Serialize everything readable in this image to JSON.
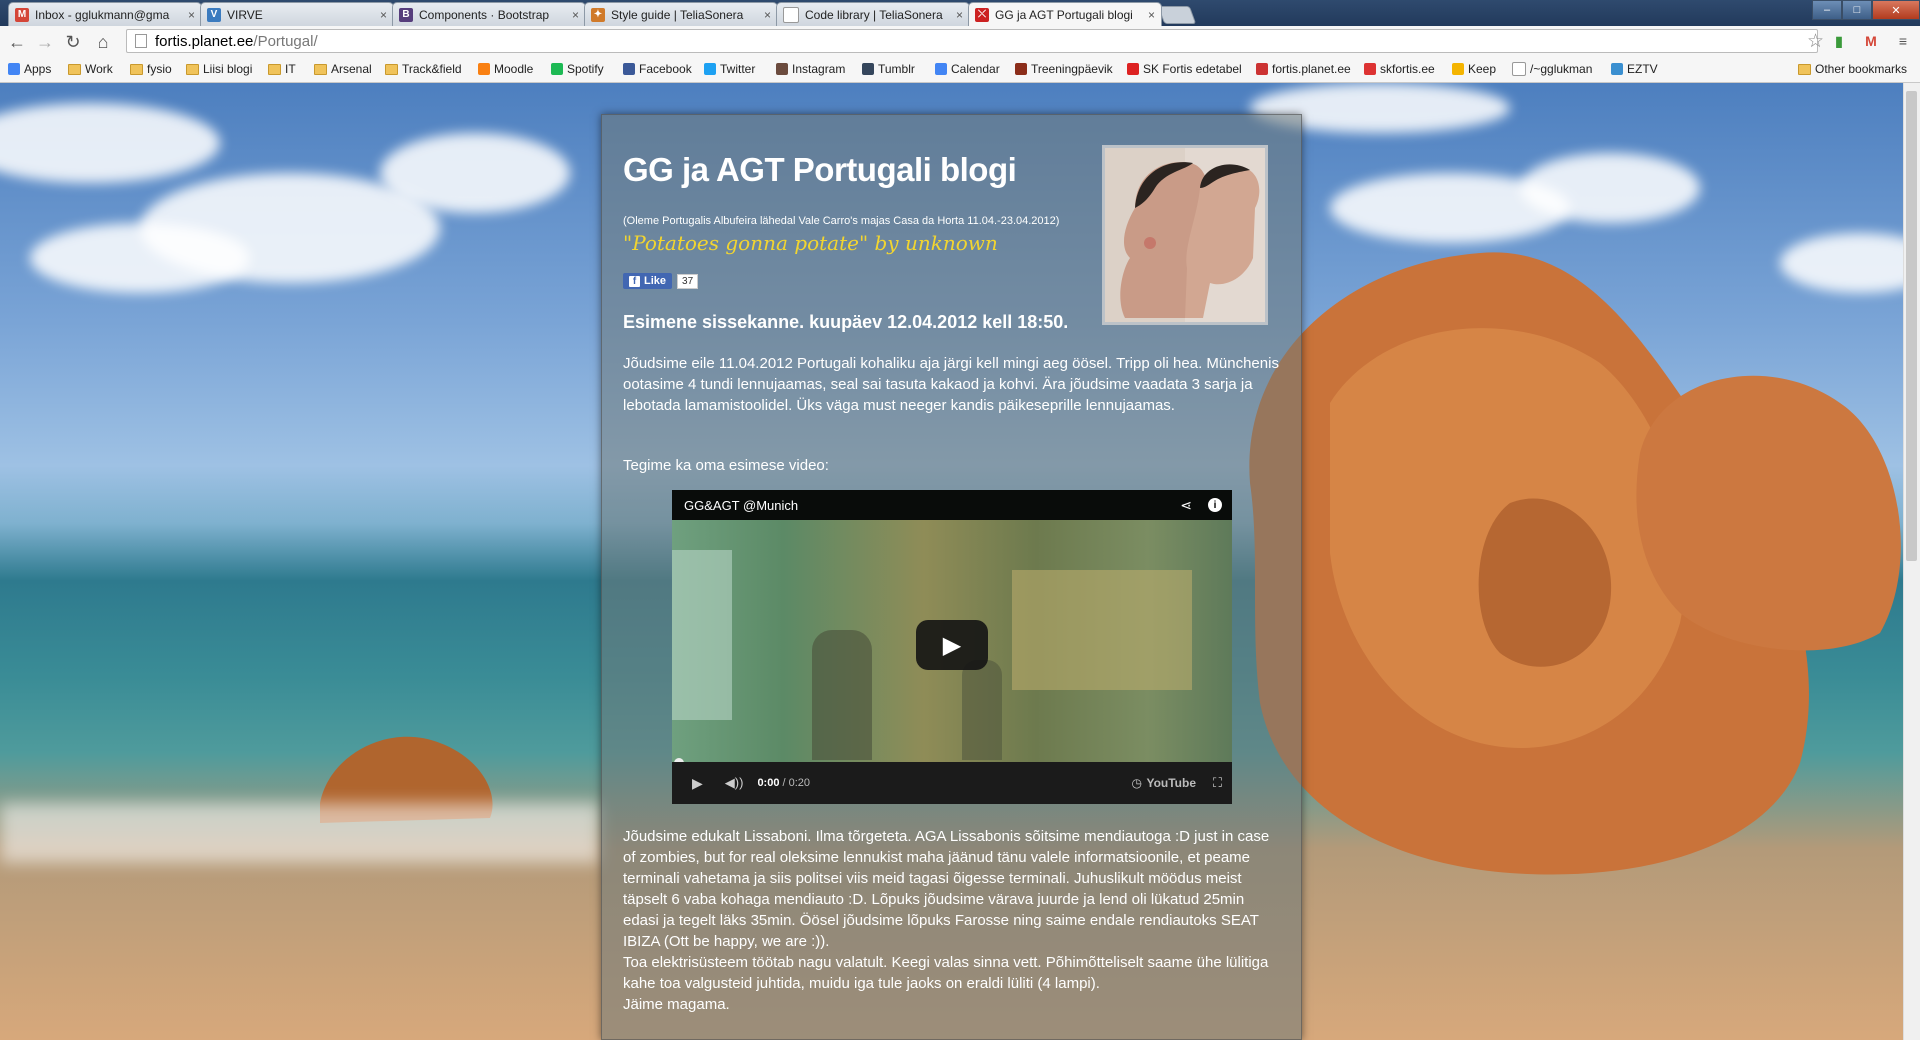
{
  "browser": {
    "tabs": [
      {
        "title": "Inbox - gglukmann@gma",
        "favicon": "gmail-icon",
        "color": "#d44638",
        "glyph": "M"
      },
      {
        "title": "VIRVE",
        "favicon": "virve-icon",
        "color": "#3b7bbf",
        "glyph": "V"
      },
      {
        "title": "Components · Bootstrap",
        "favicon": "bootstrap-icon",
        "color": "#563d7c",
        "glyph": "B"
      },
      {
        "title": "Style guide | TeliaSonera",
        "favicon": "telia-icon",
        "color": "#d07a2a",
        "glyph": "✦"
      },
      {
        "title": "Code library | TeliaSonera",
        "favicon": "page-icon",
        "color": "#ffffff",
        "glyph": ""
      },
      {
        "title": "GG ja AGT Portugali blogi",
        "favicon": "fortis-icon",
        "color": "#cc2222",
        "glyph": "⤬",
        "active": true
      }
    ],
    "url_host": "fortis.planet.ee",
    "url_path": "/Portugal/",
    "bookmarks": [
      {
        "label": "Apps",
        "icon": "apps-icon"
      },
      {
        "label": "Work",
        "icon": "folder-icon"
      },
      {
        "label": "fysio",
        "icon": "folder-icon"
      },
      {
        "label": "Liisi blogi",
        "icon": "folder-icon"
      },
      {
        "label": "IT",
        "icon": "folder-icon"
      },
      {
        "label": "Arsenal",
        "icon": "folder-icon"
      },
      {
        "label": "Track&field",
        "icon": "folder-icon"
      },
      {
        "label": "Moodle",
        "icon": "moodle-icon"
      },
      {
        "label": "Spotify",
        "icon": "spotify-icon"
      },
      {
        "label": "Facebook",
        "icon": "facebook-icon"
      },
      {
        "label": "Twitter",
        "icon": "twitter-icon"
      },
      {
        "label": "Instagram",
        "icon": "instagram-icon"
      },
      {
        "label": "Tumblr",
        "icon": "tumblr-icon"
      },
      {
        "label": "Calendar",
        "icon": "calendar-icon"
      },
      {
        "label": "Treeningpäevik",
        "icon": "shoe-icon"
      },
      {
        "label": "SK Fortis edetabel",
        "icon": "fortis-icon"
      },
      {
        "label": "fortis.planet.ee",
        "icon": "planet-icon"
      },
      {
        "label": "skfortis.ee",
        "icon": "skfortis-icon"
      },
      {
        "label": "Keep",
        "icon": "keep-icon"
      },
      {
        "label": "/~gglukman",
        "icon": "page-icon"
      },
      {
        "label": "EZTV",
        "icon": "eztv-icon"
      }
    ],
    "other_bookmarks": "Other bookmarks"
  },
  "blog": {
    "title": "GG ja AGT Portugali blogi",
    "subtitle": "(Oleme Portugalis Albufeira lähedal Vale Carro's majas Casa da Horta 11.04.-23.04.2012)",
    "quote": "\"Potatoes gonna potate\" by unknown",
    "like_label": "Like",
    "like_count": "37",
    "entry_title": "Esimene sissekanne. kuupäev 12.04.2012 kell 18:50.",
    "para1": "Jõudsime eile 11.04.2012 Portugali kohaliku aja järgi kell mingi aeg öösel. Tripp oli hea. Münchenis ootasime 4 tundi lennujaamas, seal sai tasuta kakaod ja kohvi. Ära jõudsime vaadata 3 sarja ja lebotada lamamistoolidel. Üks väga must neeger kandis päikeseprille lennujaamas.",
    "para2": "Tegime ka oma esimese video:",
    "para3": "Jõudsime edukalt Lissaboni. Ilma tõrgeteta. AGA Lissabonis sõitsime mendiautoga :D just in case of zombies, but for real oleksime lennukist maha jäänud tänu valele informatsioonile, et peame terminali vahetama ja siis politsei viis meid tagasi õigesse terminali. Juhuslikult möödus meist täpselt 6 vaba kohaga mendiauto :D. Lõpuks jõudsime värava juurde ja lend oli lükatud 25min edasi ja tegelt läks 35min. Öösel jõudsime lõpuks Farosse ning saime endale rendiautoks SEAT IBIZA (Ott be happy, we are :)).",
    "para4": "Toa elektrisüsteem töötab nagu valatult. Keegi valas sinna vett. Põhimõtteliselt saame ühe lülitiga kahe toa valgusteid juhtida, muidu iga tule jaoks on eraldi lüliti (4 lampi).",
    "para5": "Jäime magama."
  },
  "video": {
    "title": "GG&AGT @Munich",
    "time_current": "0:00",
    "time_total": "/ 0:20",
    "brand": "YouTube",
    "progress": 0
  }
}
